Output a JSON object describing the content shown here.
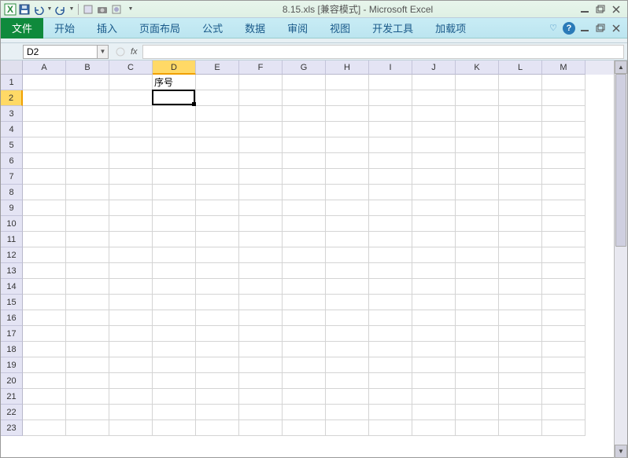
{
  "title": "8.15.xls  [兼容模式]  -  Microsoft Excel",
  "qat": {
    "save": "保存",
    "undo": "撤销",
    "redo": "重做"
  },
  "ribbon": {
    "file": "文件",
    "tabs": [
      "开始",
      "插入",
      "页面布局",
      "公式",
      "数据",
      "审阅",
      "视图",
      "开发工具",
      "加载项"
    ]
  },
  "namebox": {
    "value": "D2"
  },
  "fx": {
    "label": "fx"
  },
  "formula": {
    "value": ""
  },
  "columns": [
    "A",
    "B",
    "C",
    "D",
    "E",
    "F",
    "G",
    "H",
    "I",
    "J",
    "K",
    "L",
    "M"
  ],
  "rows": [
    1,
    2,
    3,
    4,
    5,
    6,
    7,
    8,
    9,
    10,
    11,
    12,
    13,
    14,
    15,
    16,
    17,
    18,
    19,
    20,
    21,
    22,
    23
  ],
  "cells": {
    "D1": "序号"
  },
  "active": {
    "col": "D",
    "row": 2
  }
}
